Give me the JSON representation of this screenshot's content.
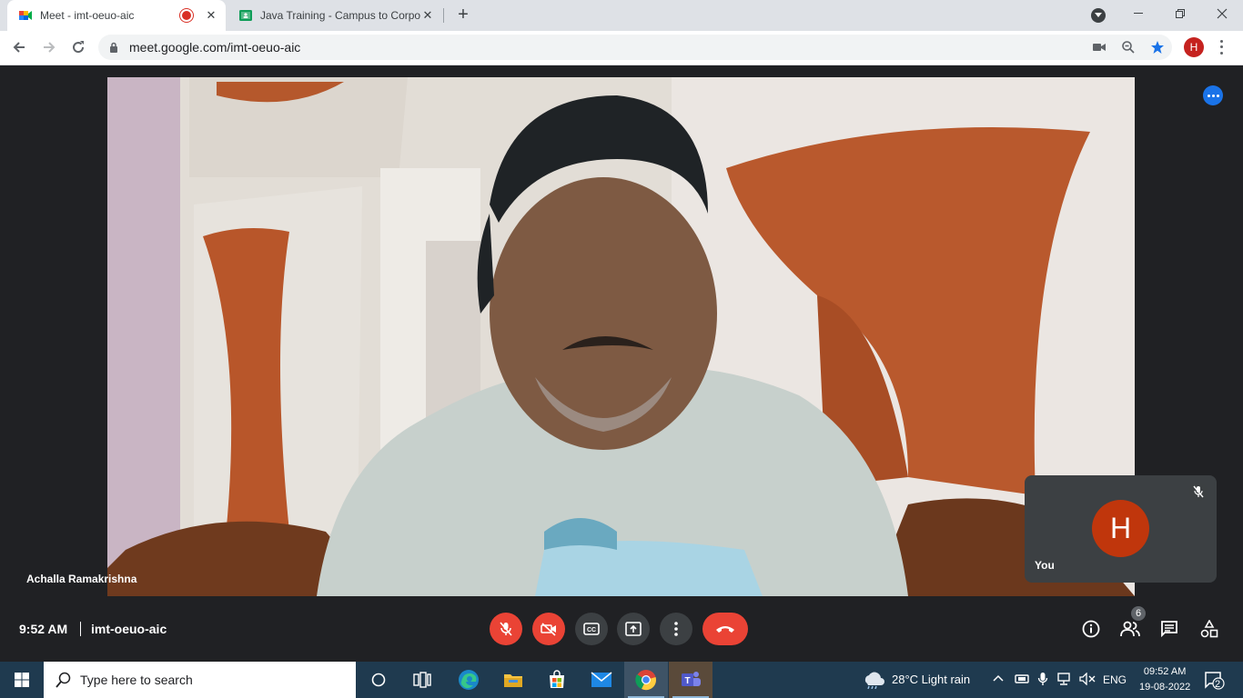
{
  "browser": {
    "tabs": [
      {
        "title": "Meet - imt-oeuo-aic",
        "active": true,
        "recording": true
      },
      {
        "title": "Java Training - Campus to Corpo",
        "active": false
      }
    ],
    "url": "meet.google.com/imt-oeuo-aic",
    "profile_initial": "H"
  },
  "meet": {
    "speaker_name": "Achalla Ramakrishna",
    "self_tile": {
      "initial": "H",
      "label": "You"
    },
    "time": "9:52 AM",
    "meeting_code": "imt-oeuo-aic",
    "participants_count": "6",
    "controls": [
      {
        "name": "mic-off-icon",
        "state": "off"
      },
      {
        "name": "camera-off-icon",
        "state": "off"
      },
      {
        "name": "captions-icon"
      },
      {
        "name": "present-screen-icon"
      },
      {
        "name": "more-options-icon"
      },
      {
        "name": "end-call-icon"
      }
    ],
    "colors": {
      "danger": "#ea4335",
      "dark": "#202124",
      "accent": "#1a73e8",
      "avatar": "#c0360c"
    }
  },
  "taskbar": {
    "search_placeholder": "Type here to search",
    "weather": "28°C  Light rain",
    "language": "ENG",
    "time": "09:52 AM",
    "date": "19-08-2022",
    "notifications": "2"
  }
}
